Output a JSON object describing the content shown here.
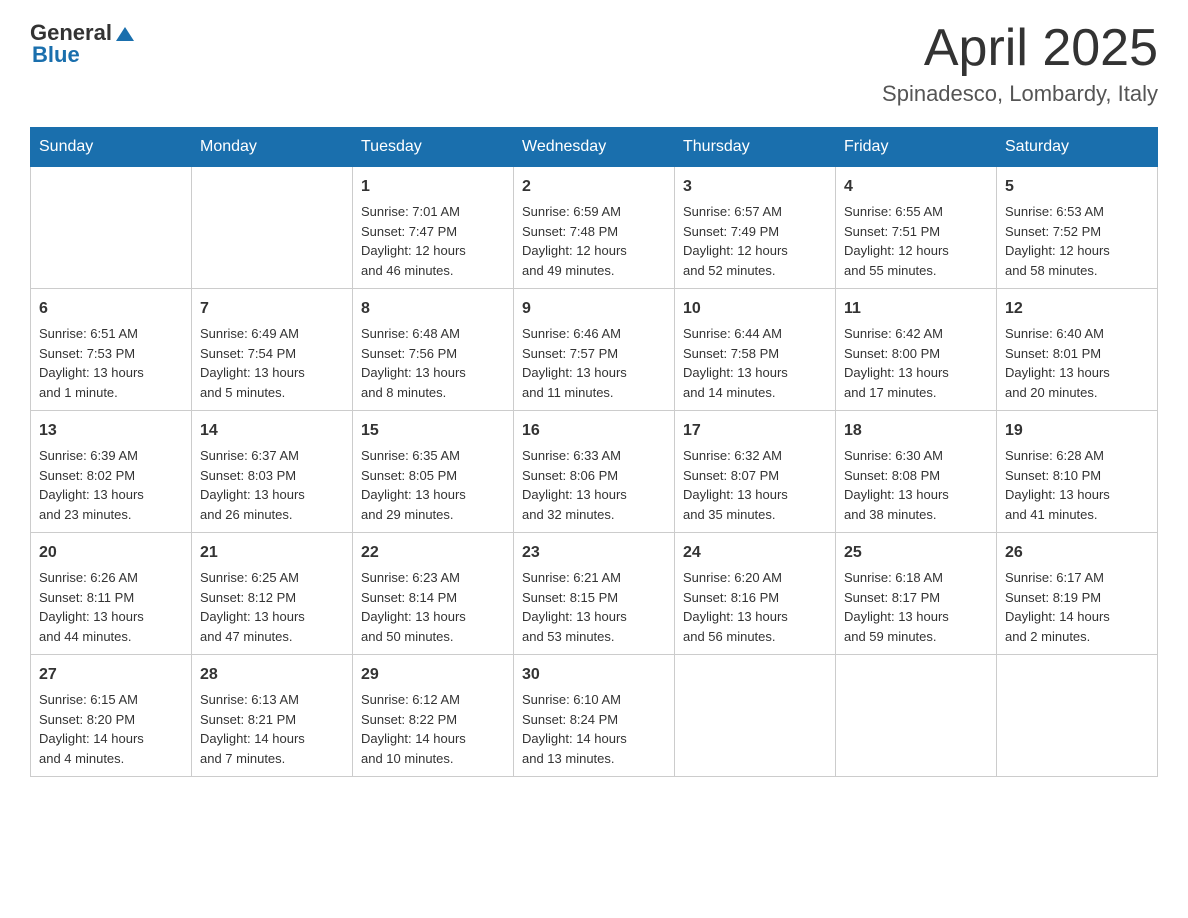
{
  "logo": {
    "general": "General",
    "blue": "Blue"
  },
  "title": "April 2025",
  "subtitle": "Spinadesco, Lombardy, Italy",
  "headers": [
    "Sunday",
    "Monday",
    "Tuesday",
    "Wednesday",
    "Thursday",
    "Friday",
    "Saturday"
  ],
  "weeks": [
    [
      {
        "day": "",
        "info": ""
      },
      {
        "day": "",
        "info": ""
      },
      {
        "day": "1",
        "info": "Sunrise: 7:01 AM\nSunset: 7:47 PM\nDaylight: 12 hours\nand 46 minutes."
      },
      {
        "day": "2",
        "info": "Sunrise: 6:59 AM\nSunset: 7:48 PM\nDaylight: 12 hours\nand 49 minutes."
      },
      {
        "day": "3",
        "info": "Sunrise: 6:57 AM\nSunset: 7:49 PM\nDaylight: 12 hours\nand 52 minutes."
      },
      {
        "day": "4",
        "info": "Sunrise: 6:55 AM\nSunset: 7:51 PM\nDaylight: 12 hours\nand 55 minutes."
      },
      {
        "day": "5",
        "info": "Sunrise: 6:53 AM\nSunset: 7:52 PM\nDaylight: 12 hours\nand 58 minutes."
      }
    ],
    [
      {
        "day": "6",
        "info": "Sunrise: 6:51 AM\nSunset: 7:53 PM\nDaylight: 13 hours\nand 1 minute."
      },
      {
        "day": "7",
        "info": "Sunrise: 6:49 AM\nSunset: 7:54 PM\nDaylight: 13 hours\nand 5 minutes."
      },
      {
        "day": "8",
        "info": "Sunrise: 6:48 AM\nSunset: 7:56 PM\nDaylight: 13 hours\nand 8 minutes."
      },
      {
        "day": "9",
        "info": "Sunrise: 6:46 AM\nSunset: 7:57 PM\nDaylight: 13 hours\nand 11 minutes."
      },
      {
        "day": "10",
        "info": "Sunrise: 6:44 AM\nSunset: 7:58 PM\nDaylight: 13 hours\nand 14 minutes."
      },
      {
        "day": "11",
        "info": "Sunrise: 6:42 AM\nSunset: 8:00 PM\nDaylight: 13 hours\nand 17 minutes."
      },
      {
        "day": "12",
        "info": "Sunrise: 6:40 AM\nSunset: 8:01 PM\nDaylight: 13 hours\nand 20 minutes."
      }
    ],
    [
      {
        "day": "13",
        "info": "Sunrise: 6:39 AM\nSunset: 8:02 PM\nDaylight: 13 hours\nand 23 minutes."
      },
      {
        "day": "14",
        "info": "Sunrise: 6:37 AM\nSunset: 8:03 PM\nDaylight: 13 hours\nand 26 minutes."
      },
      {
        "day": "15",
        "info": "Sunrise: 6:35 AM\nSunset: 8:05 PM\nDaylight: 13 hours\nand 29 minutes."
      },
      {
        "day": "16",
        "info": "Sunrise: 6:33 AM\nSunset: 8:06 PM\nDaylight: 13 hours\nand 32 minutes."
      },
      {
        "day": "17",
        "info": "Sunrise: 6:32 AM\nSunset: 8:07 PM\nDaylight: 13 hours\nand 35 minutes."
      },
      {
        "day": "18",
        "info": "Sunrise: 6:30 AM\nSunset: 8:08 PM\nDaylight: 13 hours\nand 38 minutes."
      },
      {
        "day": "19",
        "info": "Sunrise: 6:28 AM\nSunset: 8:10 PM\nDaylight: 13 hours\nand 41 minutes."
      }
    ],
    [
      {
        "day": "20",
        "info": "Sunrise: 6:26 AM\nSunset: 8:11 PM\nDaylight: 13 hours\nand 44 minutes."
      },
      {
        "day": "21",
        "info": "Sunrise: 6:25 AM\nSunset: 8:12 PM\nDaylight: 13 hours\nand 47 minutes."
      },
      {
        "day": "22",
        "info": "Sunrise: 6:23 AM\nSunset: 8:14 PM\nDaylight: 13 hours\nand 50 minutes."
      },
      {
        "day": "23",
        "info": "Sunrise: 6:21 AM\nSunset: 8:15 PM\nDaylight: 13 hours\nand 53 minutes."
      },
      {
        "day": "24",
        "info": "Sunrise: 6:20 AM\nSunset: 8:16 PM\nDaylight: 13 hours\nand 56 minutes."
      },
      {
        "day": "25",
        "info": "Sunrise: 6:18 AM\nSunset: 8:17 PM\nDaylight: 13 hours\nand 59 minutes."
      },
      {
        "day": "26",
        "info": "Sunrise: 6:17 AM\nSunset: 8:19 PM\nDaylight: 14 hours\nand 2 minutes."
      }
    ],
    [
      {
        "day": "27",
        "info": "Sunrise: 6:15 AM\nSunset: 8:20 PM\nDaylight: 14 hours\nand 4 minutes."
      },
      {
        "day": "28",
        "info": "Sunrise: 6:13 AM\nSunset: 8:21 PM\nDaylight: 14 hours\nand 7 minutes."
      },
      {
        "day": "29",
        "info": "Sunrise: 6:12 AM\nSunset: 8:22 PM\nDaylight: 14 hours\nand 10 minutes."
      },
      {
        "day": "30",
        "info": "Sunrise: 6:10 AM\nSunset: 8:24 PM\nDaylight: 14 hours\nand 13 minutes."
      },
      {
        "day": "",
        "info": ""
      },
      {
        "day": "",
        "info": ""
      },
      {
        "day": "",
        "info": ""
      }
    ]
  ]
}
